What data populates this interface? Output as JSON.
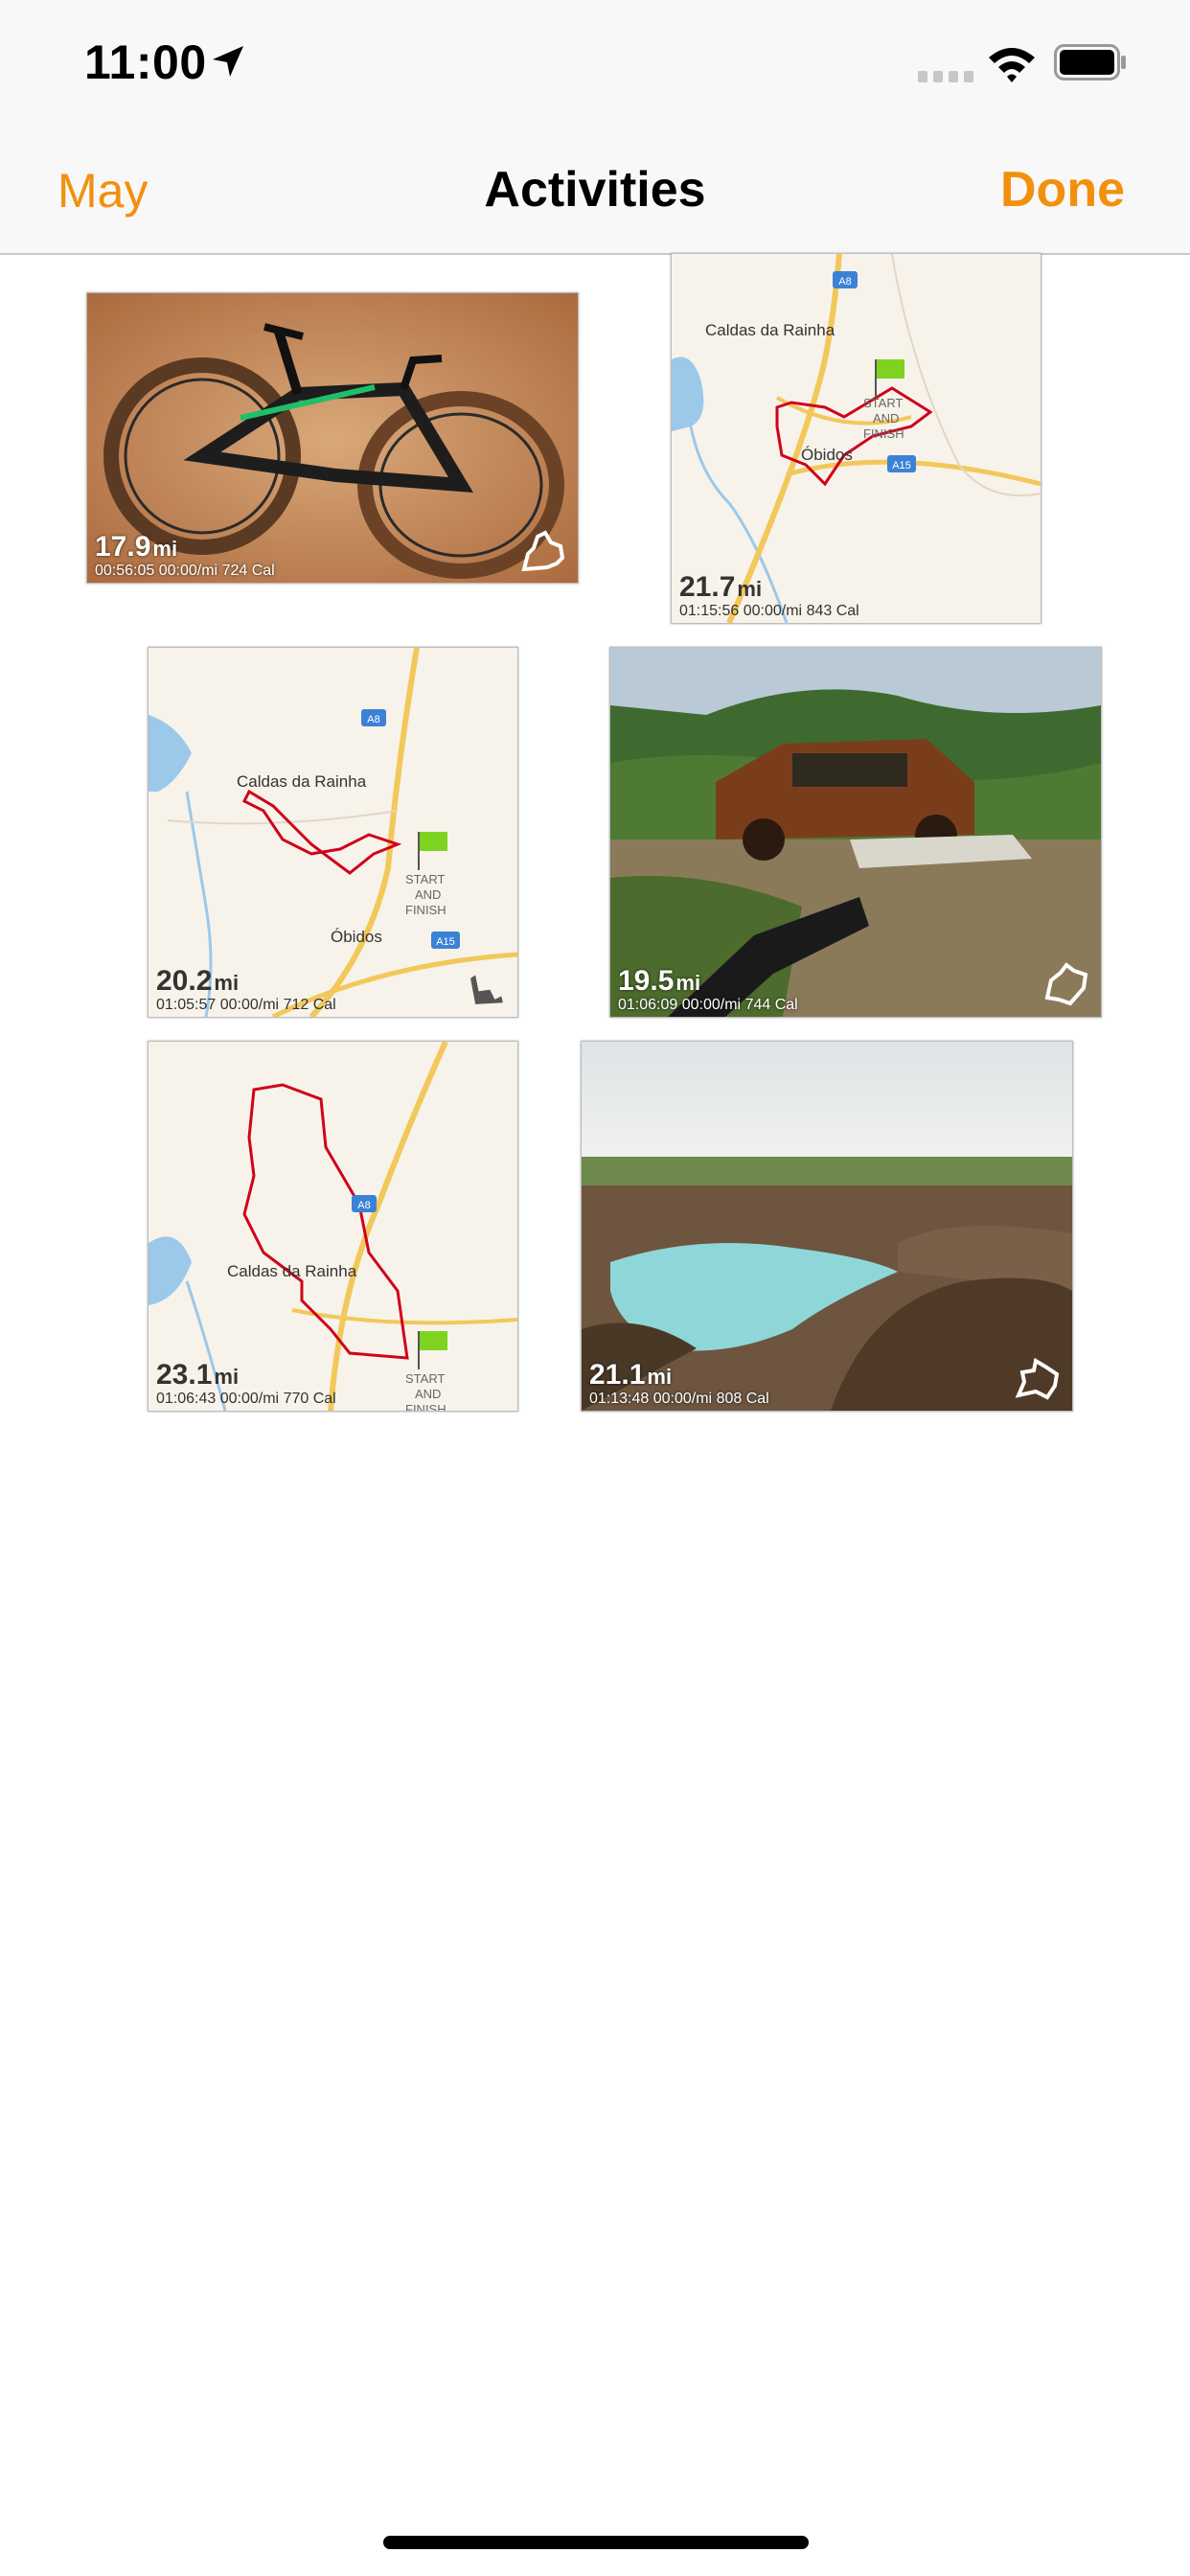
{
  "status_bar": {
    "time": "11:00",
    "icons": [
      "location-arrow-icon",
      "cellular-signal-icon",
      "wifi-icon",
      "battery-icon"
    ]
  },
  "nav": {
    "back_label": "May",
    "title": "Activities",
    "done_label": "Done"
  },
  "colors": {
    "accent": "#f2900e",
    "route": "#d0021b",
    "flag": "#7ed321"
  },
  "activities": [
    {
      "distance": "17.9",
      "unit": "mi",
      "duration": "00:56:05",
      "pace": "00:00/mi",
      "calories": "724 Cal",
      "thumb": "photo-bike",
      "icon": "sport-map-icon"
    },
    {
      "distance": "21.7",
      "unit": "mi",
      "duration": "01:15:56",
      "pace": "00:00/mi",
      "calories": "843 Cal",
      "thumb": "route-map"
    },
    {
      "distance": "20.2",
      "unit": "mi",
      "duration": "01:05:57",
      "pace": "00:00/mi",
      "calories": "712 Cal",
      "thumb": "route-map",
      "icon": "sport-map-icon"
    },
    {
      "distance": "19.5",
      "unit": "mi",
      "duration": "01:06:09",
      "pace": "00:00/mi",
      "calories": "744 Cal",
      "thumb": "photo-car",
      "icon": "sport-map-icon"
    },
    {
      "distance": "23.1",
      "unit": "mi",
      "duration": "01:06:43",
      "pace": "00:00/mi",
      "calories": "770 Cal",
      "thumb": "route-map"
    },
    {
      "distance": "21.1",
      "unit": "mi",
      "duration": "01:13:48",
      "pace": "00:00/mi",
      "calories": "808 Cal",
      "thumb": "photo-lake",
      "icon": "sport-map-icon"
    }
  ],
  "map_labels": {
    "town1": "Caldas da Rainha",
    "town2": "Óbidos",
    "road_a8": "A8",
    "road_a15": "A15",
    "start": "START",
    "and": "AND",
    "finish": "FINISH"
  }
}
